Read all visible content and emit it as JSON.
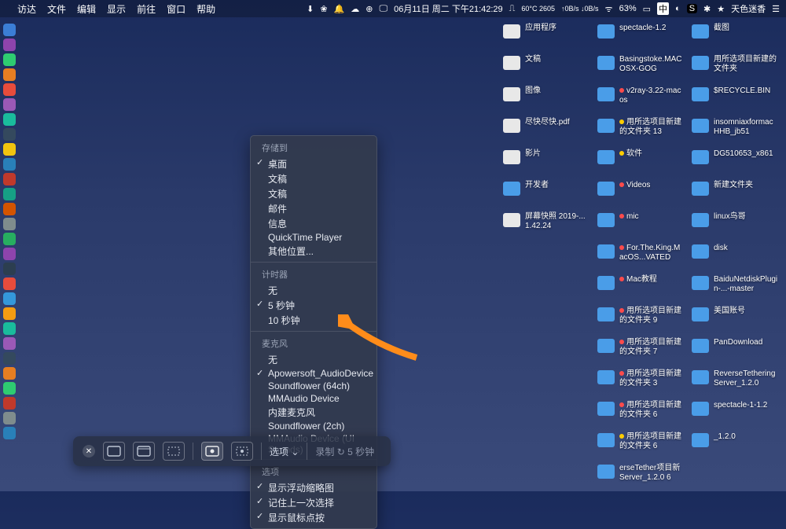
{
  "menubar": {
    "apple_icon": "",
    "items": [
      "访达",
      "文件",
      "编辑",
      "显示",
      "前往",
      "窗口",
      "帮助"
    ],
    "date": "06月11日 周二 下午21:42:29",
    "temp": "60°C 2605",
    "net": "↑0B/s ↓0B/s",
    "battery": "63%",
    "ime": "中",
    "weather": "天色迷香"
  },
  "menu": {
    "save_to_head": "存储到",
    "save_to": [
      "桌面",
      "文稿",
      "文稿",
      "邮件",
      "信息",
      "QuickTime Player",
      "其他位置..."
    ],
    "save_to_checked": 0,
    "timer_head": "计时器",
    "timer": [
      "无",
      "5 秒钟",
      "10 秒钟"
    ],
    "timer_checked": 1,
    "mic_head": "麦克风",
    "mic": [
      "无",
      "Apowersoft_AudioDevice",
      "Soundflower (64ch)",
      "MMAudio Device",
      "内建麦克风",
      "Soundflower (2ch)",
      "MMAudio Device (UI Sounds)"
    ],
    "mic_checked": 1,
    "options_head": "选项",
    "options": [
      "显示浮动缩略图",
      "记住上一次选择",
      "显示鼠标点按"
    ],
    "options_checked": [
      true,
      true,
      true
    ]
  },
  "toolbar": {
    "options_label": "选项",
    "record_label": "录制",
    "countdown": "5 秒钟"
  },
  "desktop": {
    "col1": [
      {
        "label": "应用程序",
        "type": "file"
      },
      {
        "label": "文稿",
        "type": "file"
      },
      {
        "label": "图像",
        "type": "file"
      },
      {
        "label": "尽快尽快.pdf",
        "type": "file"
      },
      {
        "label": "影片",
        "type": "file"
      },
      {
        "label": "开发者",
        "type": "folder"
      },
      {
        "label": "屏幕快照 2019-...1.42.24",
        "type": "file"
      }
    ],
    "col2": [
      {
        "label": "spectacle-1.2"
      },
      {
        "label": "Basingstoke.MACOSX-GOG"
      },
      {
        "label": "v2ray-3.22-macos",
        "dot": "red"
      },
      {
        "label": "用所选项目新建的文件夹 13",
        "dot": "yel"
      },
      {
        "label": "软件",
        "dot": "yel"
      },
      {
        "label": "Videos",
        "dot": "red"
      },
      {
        "label": "mic",
        "dot": "red"
      },
      {
        "label": "For.The.King.MacOS...VATED",
        "dot": "red"
      },
      {
        "label": "Mac教程",
        "dot": "red"
      },
      {
        "label": "用所选项目新建的文件夹 9",
        "dot": "red"
      },
      {
        "label": "用所选项目新建的文件夹 7",
        "dot": "red"
      },
      {
        "label": "用所选项目新建的文件夹 3",
        "dot": "red"
      },
      {
        "label": "用所选项目新建的文件夹 6",
        "dot": "red"
      },
      {
        "label": "用所选项目新建的文件夹 6",
        "dot": "yel"
      },
      {
        "label": "erseTether项目新 Server_1.2.0 6"
      }
    ],
    "col3": [
      {
        "label": "截图"
      },
      {
        "label": "用所选项目新建的文件夹"
      },
      {
        "label": "$RECYCLE.BIN"
      },
      {
        "label": "insomniaxformacHHB_jb51"
      },
      {
        "label": "DG510653_x861"
      },
      {
        "label": "新建文件夹"
      },
      {
        "label": "linux鸟哥"
      },
      {
        "label": "disk"
      },
      {
        "label": "BaiduNetdiskPlugin-...-master"
      },
      {
        "label": "美国账号"
      },
      {
        "label": "PanDownload"
      },
      {
        "label": "ReverseTetheringServer_1.2.0"
      },
      {
        "label": "spectacle-1-1.2"
      },
      {
        "label": "_1.2.0"
      }
    ]
  },
  "dock_colors": [
    "#3b7ed6",
    "#8e44ad",
    "#2ecc71",
    "#e67e22",
    "#e74c3c",
    "#9b59b6",
    "#1abc9c",
    "#34495e",
    "#f1c40f",
    "#2980b9",
    "#c0392b",
    "#16a085",
    "#d35400",
    "#7f8c8d",
    "#27ae60",
    "#8e44ad",
    "#2c3e50",
    "#e74c3c",
    "#3498db",
    "#f39c12",
    "#1abc9c",
    "#9b59b6",
    "#34495e",
    "#e67e22",
    "#2ecc71",
    "#c0392b",
    "#7f8c8d",
    "#2980b9"
  ]
}
